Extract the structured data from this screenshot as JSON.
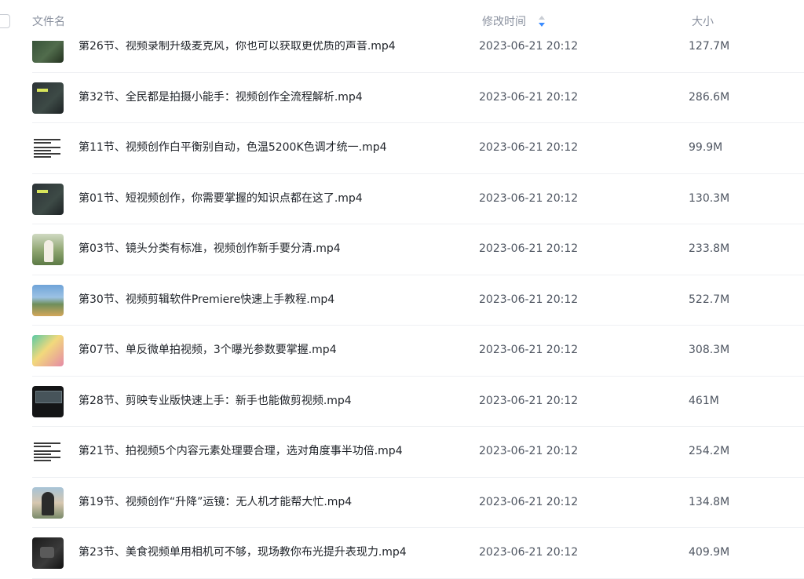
{
  "header": {
    "name_label": "文件名",
    "time_label": "修改时间",
    "size_label": "大小",
    "sort_icon": "sort-icon"
  },
  "files": [
    {
      "name": "第26节、视频录制升级麦克风，你也可以获取更优质的声音.mp4",
      "time": "2023-06-21 20:12",
      "size": "127.7M",
      "thumb": "green"
    },
    {
      "name": "第32节、全民都是拍摄小能手：视频创作全流程解析.mp4",
      "time": "2023-06-21 20:12",
      "size": "286.6M",
      "thumb": "dark"
    },
    {
      "name": "第11节、视频创作白平衡别自动，色温5200K色调才统一.mp4",
      "time": "2023-06-21 20:12",
      "size": "99.9M",
      "thumb": "doc"
    },
    {
      "name": "第01节、短视频创作，你需要掌握的知识点都在这了.mp4",
      "time": "2023-06-21 20:12",
      "size": "130.3M",
      "thumb": "dark"
    },
    {
      "name": "第03节、镜头分类有标准，视频创作新手要分清.mp4",
      "time": "2023-06-21 20:12",
      "size": "233.8M",
      "thumb": "people"
    },
    {
      "name": "第30节、视频剪辑软件Premiere快速上手教程.mp4",
      "time": "2023-06-21 20:12",
      "size": "522.7M",
      "thumb": "island"
    },
    {
      "name": "第07节、单反微单拍视频，3个曝光参数要掌握.mp4",
      "time": "2023-06-21 20:12",
      "size": "308.3M",
      "thumb": "colorful"
    },
    {
      "name": "第28节、剪映专业版快速上手：新手也能做剪视频.mp4",
      "time": "2023-06-21 20:12",
      "size": "461M",
      "thumb": "editor"
    },
    {
      "name": "第21节、拍视频5个内容元素处理要合理，选对角度事半功倍.mp4",
      "time": "2023-06-21 20:12",
      "size": "254.2M",
      "thumb": "doc"
    },
    {
      "name": "第19节、视频创作“升降”运镜：无人机才能帮大忙.mp4",
      "time": "2023-06-21 20:12",
      "size": "134.8M",
      "thumb": "person2"
    },
    {
      "name": "第23节、美食视频单用相机可不够，现场教你布光提升表现力.mp4",
      "time": "2023-06-21 20:12",
      "size": "409.9M",
      "thumb": "camera"
    }
  ],
  "colors": {
    "header_text": "#8a919f",
    "row_text": "#1f2329",
    "meta_text": "#4e5561",
    "sort_active": "#3b8cff",
    "divider": "#eef0f3"
  }
}
